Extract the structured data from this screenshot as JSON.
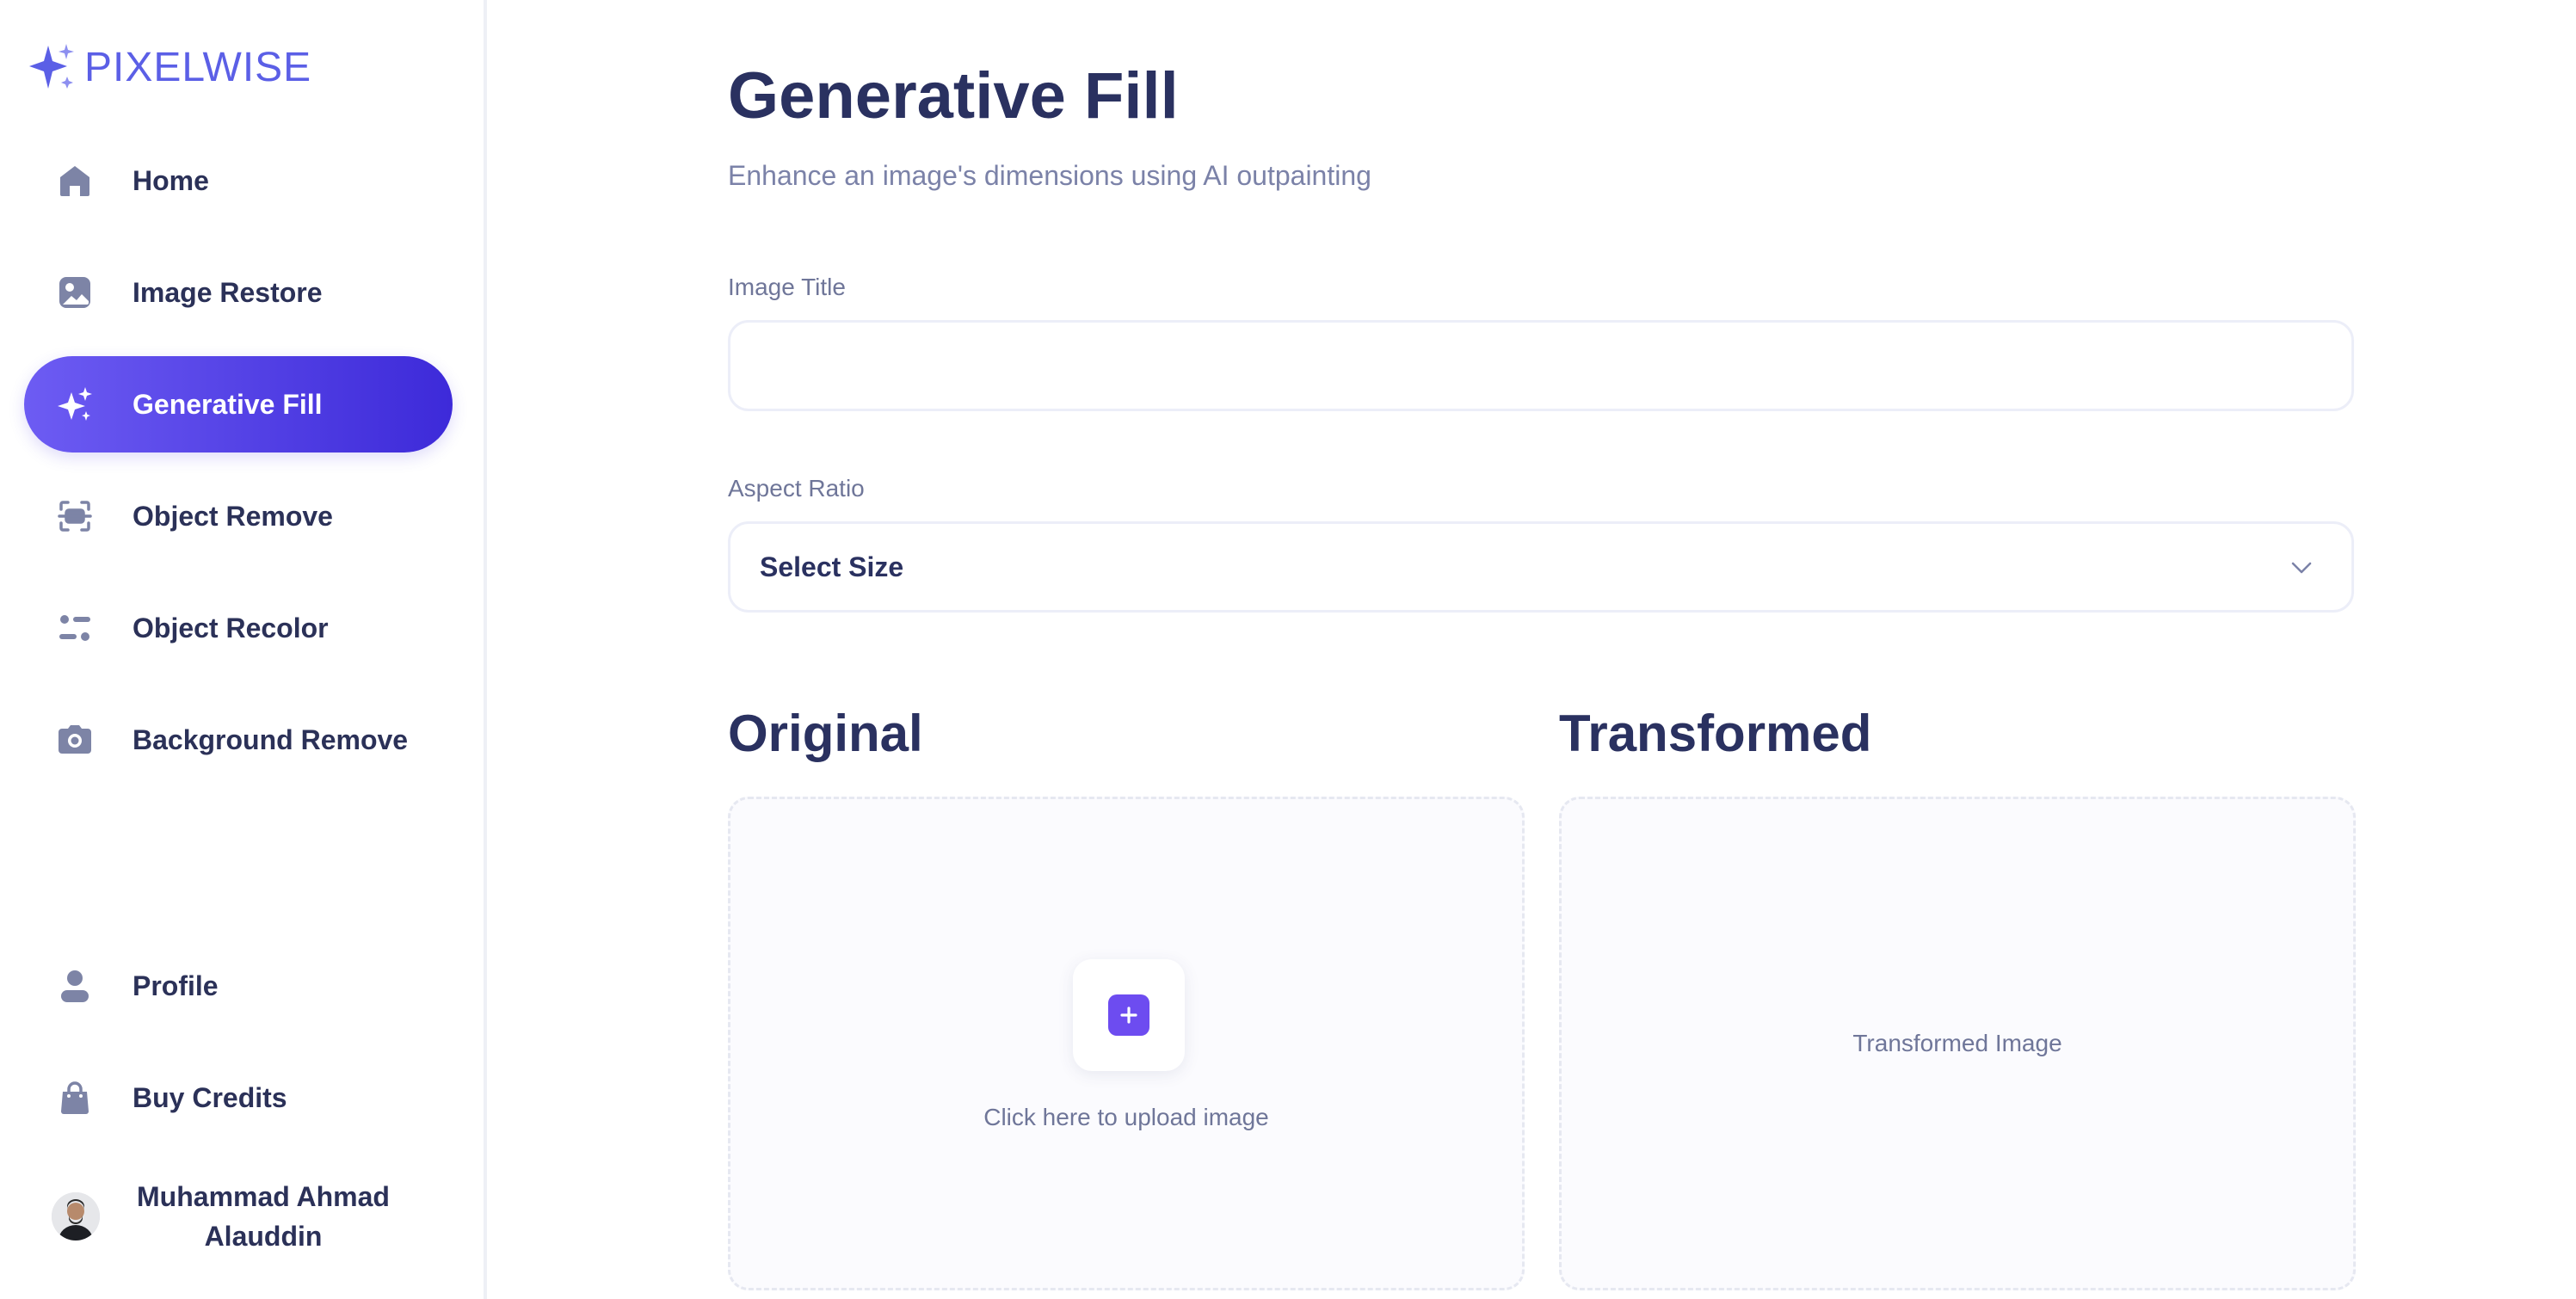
{
  "brand": {
    "name": "PIXELWISE",
    "accent": "#5b5fe6"
  },
  "sidebar": {
    "items": [
      {
        "label": "Home",
        "icon": "home-icon",
        "active": false
      },
      {
        "label": "Image Restore",
        "icon": "image-icon",
        "active": false
      },
      {
        "label": "Generative Fill",
        "icon": "sparkles-icon",
        "active": true
      },
      {
        "label": "Object Remove",
        "icon": "scan-icon",
        "active": false
      },
      {
        "label": "Object Recolor",
        "icon": "filter-icon",
        "active": false
      },
      {
        "label": "Background Remove",
        "icon": "camera-icon",
        "active": false
      }
    ],
    "bottom_items": [
      {
        "label": "Profile",
        "icon": "user-icon"
      },
      {
        "label": "Buy Credits",
        "icon": "bag-icon"
      }
    ],
    "user": {
      "name": "Muhammad Ahmad Alauddin"
    }
  },
  "page": {
    "title": "Generative Fill",
    "subtitle": "Enhance an image's dimensions using AI outpainting"
  },
  "form": {
    "title_label": "Image Title",
    "title_value": "",
    "aspect_label": "Aspect Ratio",
    "aspect_value": "Select Size"
  },
  "panels": {
    "original_heading": "Original",
    "transformed_heading": "Transformed",
    "upload_text": "Click here to upload image",
    "transformed_placeholder": "Transformed Image"
  },
  "colors": {
    "active_start": "#6d5cf3",
    "active_end": "#3d2ad9",
    "icon": "#7d84a6",
    "heading": "#2a3160"
  }
}
